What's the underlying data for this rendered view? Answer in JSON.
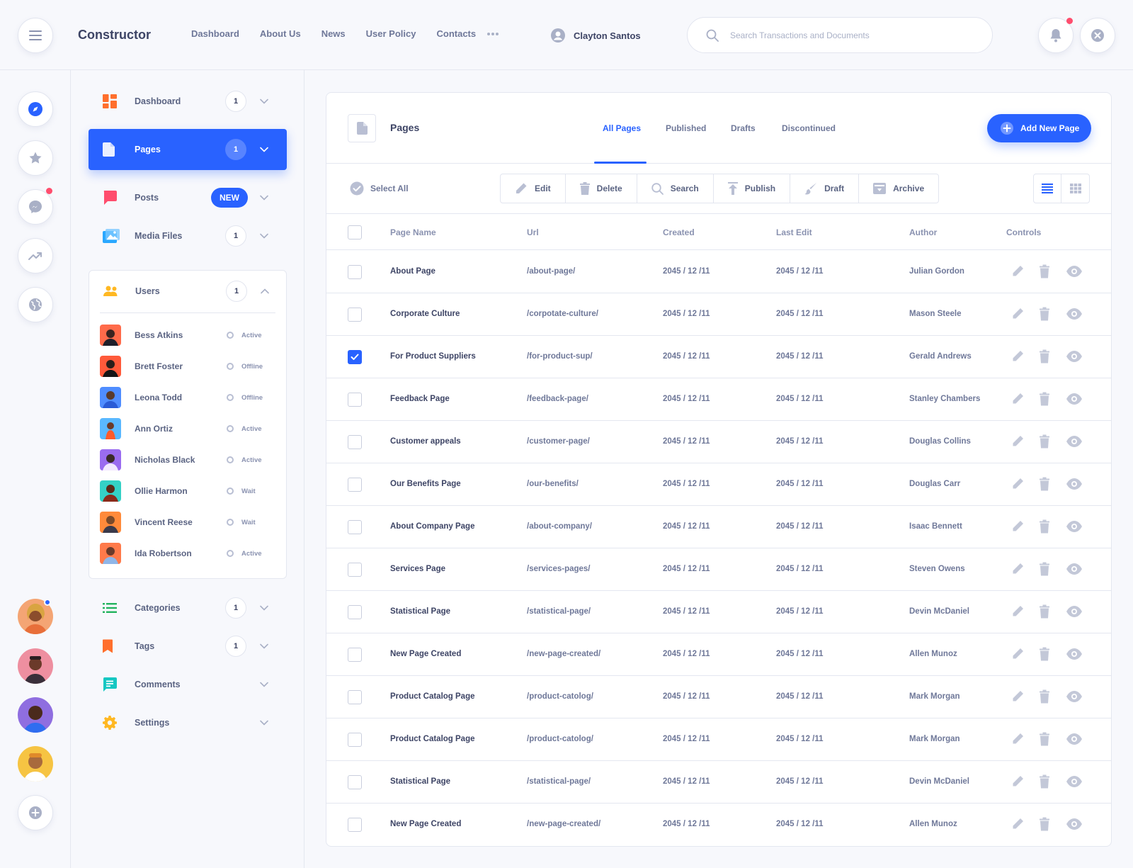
{
  "header": {
    "brand": "Constructor",
    "nav": [
      "Dashboard",
      "About Us",
      "News",
      "User Policy",
      "Contacts"
    ],
    "user_name": "Clayton Santos",
    "search_placeholder": "Search Transactions and Documents",
    "icons": {
      "menu": "hamburger-menu-icon",
      "more": "more-dots-icon",
      "user": "user-icon",
      "search": "search-icon",
      "notifications": "bell-icon",
      "close": "close-icon"
    }
  },
  "rail": {
    "icons": [
      "compass-icon",
      "star-icon",
      "messenger-icon",
      "trending-icon",
      "globe-icon"
    ],
    "add_icon": "plus-circle-icon"
  },
  "sidebar": {
    "items": [
      {
        "label": "Dashboard",
        "count": "1",
        "icon": "dashboard-icon",
        "color": "#ff6f2c"
      },
      {
        "label": "Pages",
        "count": "1",
        "icon": "page-icon",
        "color": "#ffffff"
      },
      {
        "label": "Posts",
        "badge": "NEW",
        "icon": "chat-bubble-icon",
        "color": "#ff4d6d"
      },
      {
        "label": "Media Files",
        "count": "1",
        "icon": "image-icon",
        "color": "#2aa8ff"
      },
      {
        "label": "Users",
        "count": "1",
        "icon": "users-icon",
        "color": "#ffb822"
      },
      {
        "label": "Categories",
        "count": "1",
        "icon": "list-icon",
        "color": "#22b35e"
      },
      {
        "label": "Tags",
        "count": "1",
        "icon": "bookmark-icon",
        "color": "#ff6f2c"
      },
      {
        "label": "Comments",
        "icon": "comment-icon",
        "color": "#16c7c2"
      },
      {
        "label": "Settings",
        "icon": "gear-icon",
        "color": "#ffb822"
      }
    ],
    "users": [
      {
        "name": "Bess Atkins",
        "status": "Active"
      },
      {
        "name": "Brett Foster",
        "status": "Offline"
      },
      {
        "name": "Leona Todd",
        "status": "Offline"
      },
      {
        "name": "Ann Ortiz",
        "status": "Active"
      },
      {
        "name": "Nicholas Black",
        "status": "Active"
      },
      {
        "name": "Ollie Harmon",
        "status": "Wait"
      },
      {
        "name": "Vincent Reese",
        "status": "Wait"
      },
      {
        "name": "Ida Robertson",
        "status": "Active"
      }
    ]
  },
  "main": {
    "title": "Pages",
    "tabs": [
      "All Pages",
      "Published",
      "Drafts",
      "Discontinued"
    ],
    "active_tab": "All Pages",
    "add_button": "Add New Page",
    "select_all": "Select All",
    "actions": [
      {
        "label": "Edit",
        "icon": "pencil-icon"
      },
      {
        "label": "Delete",
        "icon": "trash-icon"
      },
      {
        "label": "Search",
        "icon": "search-icon"
      },
      {
        "label": "Publish",
        "icon": "upload-icon"
      },
      {
        "label": "Draft",
        "icon": "brush-icon"
      },
      {
        "label": "Archive",
        "icon": "archive-icon"
      }
    ],
    "columns": [
      "Page Name",
      "Url",
      "Created",
      "Last Edit",
      "Author",
      "Controls"
    ],
    "rows": [
      {
        "name": "About Page",
        "url": "/about-page/",
        "created": "2045 / 12 /11",
        "edited": "2045 / 12 /11",
        "author": "Julian Gordon",
        "checked": false
      },
      {
        "name": "Corporate Culture",
        "url": "/corpotate-culture/",
        "created": "2045 / 12 /11",
        "edited": "2045 / 12 /11",
        "author": "Mason Steele",
        "checked": false
      },
      {
        "name": "For Product Suppliers",
        "url": "/for-product-sup/",
        "created": "2045 / 12 /11",
        "edited": "2045 / 12 /11",
        "author": "Gerald Andrews",
        "checked": true
      },
      {
        "name": "Feedback Page",
        "url": "/feedback-page/",
        "created": "2045 / 12 /11",
        "edited": "2045 / 12 /11",
        "author": "Stanley Chambers",
        "checked": false
      },
      {
        "name": "Customer appeals",
        "url": "/customer-page/",
        "created": "2045 / 12 /11",
        "edited": "2045 / 12 /11",
        "author": "Douglas Collins",
        "checked": false
      },
      {
        "name": "Our Benefits Page",
        "url": " /our-benefits/",
        "created": "2045 / 12 /11",
        "edited": "2045 / 12 /11",
        "author": "Douglas Carr",
        "checked": false
      },
      {
        "name": "About Company Page",
        "url": "/about-company/",
        "created": "2045 / 12 /11",
        "edited": "2045 / 12 /11",
        "author": "Isaac Bennett",
        "checked": false
      },
      {
        "name": "Services Page",
        "url": "/services-pages/",
        "created": "2045 / 12 /11",
        "edited": "2045 / 12 /11",
        "author": "Steven Owens",
        "checked": false
      },
      {
        "name": "Statistical Page",
        "url": "/statistical-page/",
        "created": "2045 / 12 /11",
        "edited": "2045 / 12 /11",
        "author": "Devin McDaniel",
        "checked": false
      },
      {
        "name": "New Page Created",
        "url": "/new-page-created/",
        "created": "2045 / 12 /11",
        "edited": "2045 / 12 /11",
        "author": "Allen Munoz",
        "checked": false
      },
      {
        "name": "Product Catalog Page",
        "url": "/product-catolog/",
        "created": "2045 / 12 /11",
        "edited": "2045 / 12 /11",
        "author": "Mark Morgan",
        "checked": false
      },
      {
        "name": "Product Catalog Page",
        "url": "/product-catolog/",
        "created": "2045 / 12 /11",
        "edited": "2045 / 12 /11",
        "author": "Mark Morgan",
        "checked": false
      },
      {
        "name": "Statistical Page",
        "url": "/statistical-page/",
        "created": "2045 / 12 /11",
        "edited": "2045 / 12 /11",
        "author": "Devin McDaniel",
        "checked": false
      },
      {
        "name": "New Page Created",
        "url": "/new-page-created/",
        "created": "2045 / 12 /11",
        "edited": "2045 / 12 /11",
        "author": "Allen Munoz",
        "checked": false
      }
    ],
    "row_controls": [
      "edit-pencil-icon",
      "delete-trash-icon",
      "view-eye-icon"
    ]
  },
  "colors": {
    "accent": "#2962ff",
    "alert": "#ff4d6d",
    "background": "#f7f8fc"
  }
}
